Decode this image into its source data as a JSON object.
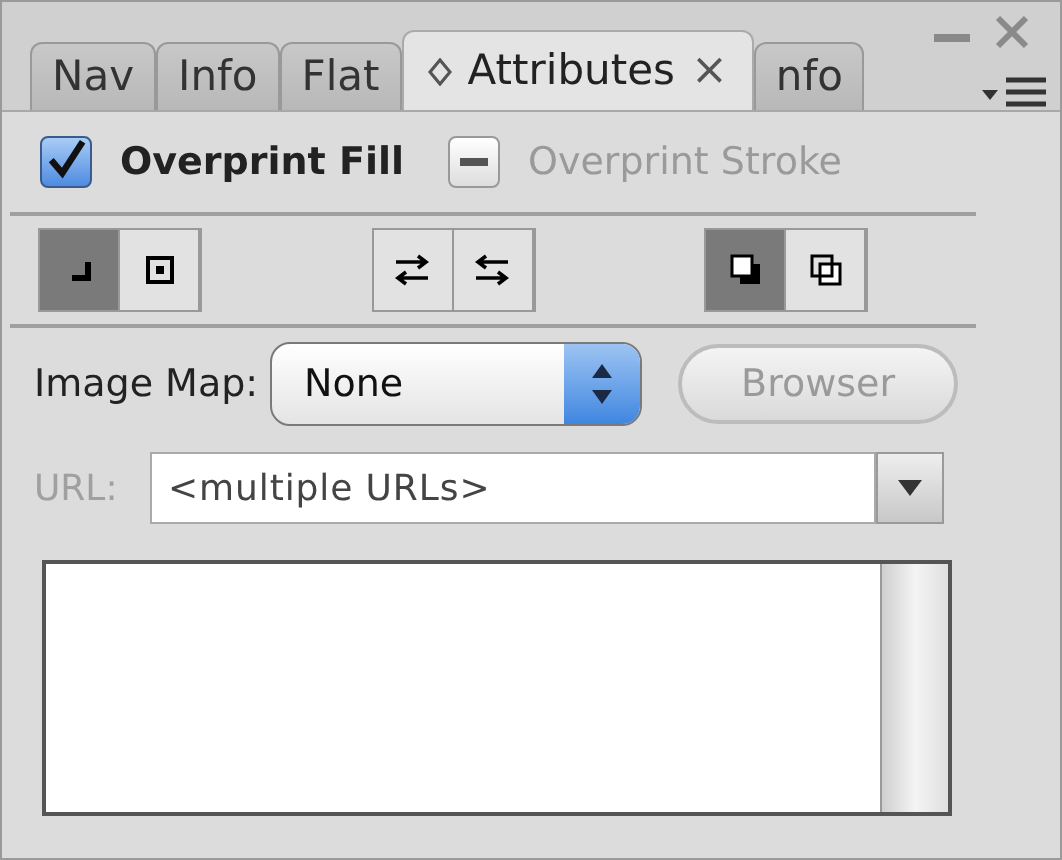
{
  "tabs": [
    {
      "label": "Nav",
      "selected": false
    },
    {
      "label": "Info",
      "selected": false
    },
    {
      "label": "Flat",
      "selected": false
    },
    {
      "label": "Attributes",
      "selected": true,
      "close": "×"
    },
    {
      "label": "nfo",
      "selected": false
    }
  ],
  "options": [
    {
      "label": "Overprint Fill",
      "checked": true,
      "mixed": false,
      "disabled": false
    },
    {
      "label": "Overprint Stroke",
      "mixed": true,
      "disabled": true
    }
  ],
  "toolbar": [
    {
      "buttons": [
        {
          "kind": "corner",
          "selected": true
        },
        {
          "kind": "center",
          "selected": false
        }
      ]
    },
    {
      "buttons": [
        {
          "kind": "swap-left",
          "selected": false
        },
        {
          "kind": "swap-right",
          "selected": false
        }
      ]
    },
    {
      "buttons": [
        {
          "kind": "front",
          "selected": true
        },
        {
          "kind": "back",
          "selected": false
        }
      ]
    }
  ],
  "image_map": {
    "label": "Image Map:",
    "value": "None"
  },
  "browser_button": {
    "label": "Browser",
    "disabled": true
  },
  "url": {
    "label": "URL:",
    "value": "<multiple URLs>",
    "disabled": true
  }
}
